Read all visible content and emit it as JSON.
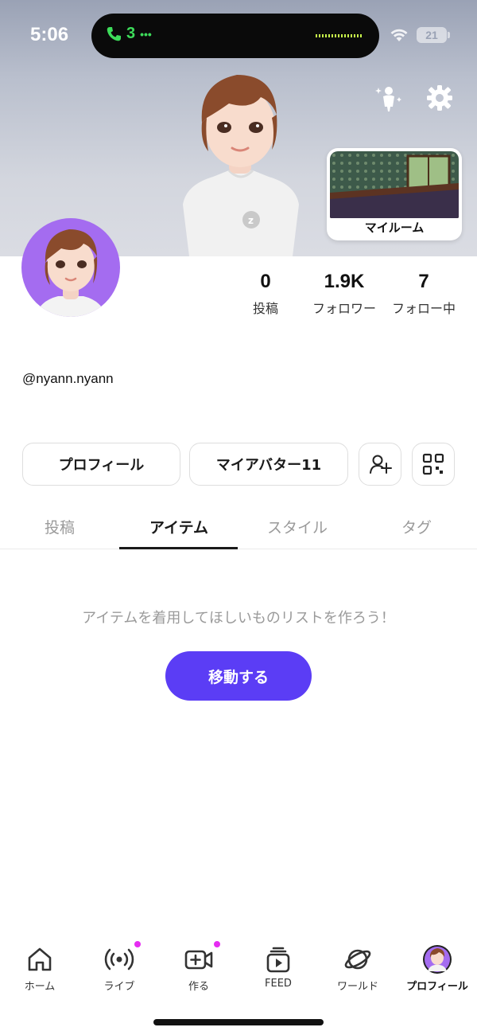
{
  "status_bar": {
    "time": "5:06",
    "call_indicator": "3",
    "battery": "21"
  },
  "hero": {
    "myroom_label": "マイルーム",
    "icons": [
      "avatar-sparkle-icon",
      "gear-icon"
    ]
  },
  "profile": {
    "username": "@nyann.nyann",
    "stats": [
      {
        "value": "0",
        "label": "投稿"
      },
      {
        "value": "1.9K",
        "label": "フォロワー"
      },
      {
        "value": "7",
        "label": "フォロー中"
      }
    ]
  },
  "actions": {
    "profile_button": "プロフィール",
    "my_avatar_button": "マイアバター11",
    "add_friend_icon": "add-friend-icon",
    "qr_icon": "qr-code-icon"
  },
  "tabs": [
    {
      "label": "投稿",
      "active": false
    },
    {
      "label": "アイテム",
      "active": true
    },
    {
      "label": "スタイル",
      "active": false
    },
    {
      "label": "タグ",
      "active": false
    }
  ],
  "content": {
    "empty_message": "アイテムを着用してほしいものリストを作ろう！",
    "move_button": "移動する"
  },
  "bottom_nav": [
    {
      "label": "ホーム",
      "icon": "home-icon",
      "active": false
    },
    {
      "label": "ライブ",
      "icon": "live-icon",
      "active": false
    },
    {
      "label": "作る",
      "icon": "create-video-icon",
      "active": false
    },
    {
      "label": "FEED",
      "icon": "feed-icon",
      "active": false
    },
    {
      "label": "ワールド",
      "icon": "world-planet-icon",
      "active": false
    },
    {
      "label": "プロフィール",
      "icon": "profile-avatar-icon",
      "active": true
    }
  ],
  "colors": {
    "accent": "#5b3df5",
    "avatar_bg": "#a46cf0",
    "badge": "#e62cf2",
    "call_green": "#3ddc5a"
  }
}
